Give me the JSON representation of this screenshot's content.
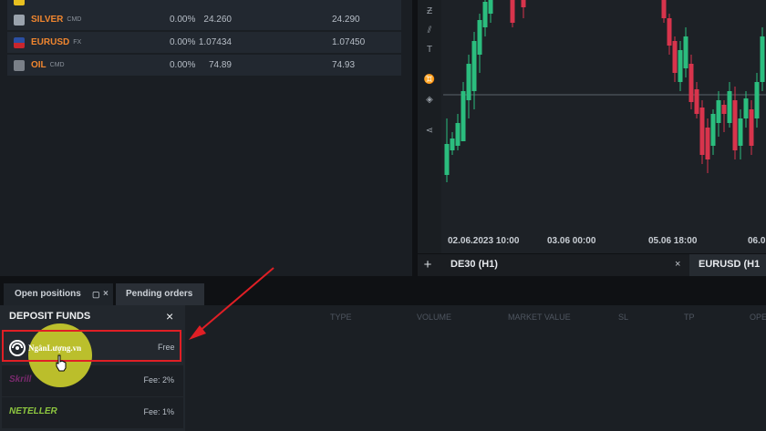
{
  "watchlist": {
    "rows": [
      {
        "symbol": "SILVER",
        "type": "CMD",
        "change": "0.00%",
        "bid": "24.260",
        "ask": "24.290",
        "flag_color": "#9aa3ad"
      },
      {
        "symbol": "EURUSD",
        "type": "FX",
        "change": "0.00%",
        "bid": "1.07434",
        "ask": "1.07450",
        "flag_color": "#2b4fa3"
      },
      {
        "symbol": "OIL",
        "type": "CMD",
        "change": "0.00%",
        "bid": "74.89",
        "ask": "74.93",
        "flag_color": "#7a8088"
      }
    ]
  },
  "chart": {
    "x_labels": [
      "02.06.2023 10:00",
      "03.06 00:00",
      "05.06 18:00",
      "06.0"
    ],
    "tabs": {
      "active": "DE30 (H1)",
      "second": "EURUSD (H1"
    },
    "plus": "+",
    "close": "×",
    "tools": [
      "Ƶ",
      "⫽",
      "T",
      "♊",
      "◈",
      "⋖"
    ],
    "up_color": "#2bbd7e",
    "down_color": "#d8344c"
  },
  "bottom": {
    "tabs": {
      "open_positions": "Open positions",
      "pending_orders": "Pending orders"
    },
    "columns": [
      "TYPE",
      "VOLUME",
      "MARKET VALUE",
      "SL",
      "TP",
      "OPE"
    ]
  },
  "deposit": {
    "title": "DEPOSIT FUNDS",
    "close": "×",
    "methods": [
      {
        "name": "NgânLượng.vn",
        "fee": "Free",
        "logo_color": "#ffffff"
      },
      {
        "name": "Skrill",
        "fee": "Fee: 2%",
        "logo_color": "#7a2a6e"
      },
      {
        "name": "NETELLER",
        "fee": "Fee: 1%",
        "logo_color": "#8dc63f"
      }
    ]
  },
  "colors": {
    "accent": "#f0862f",
    "highlight": "#e01f25",
    "cursor_circle": "#c9cc2c"
  }
}
